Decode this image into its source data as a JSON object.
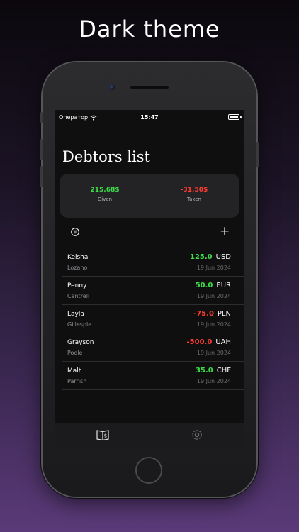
{
  "headline": "Dark theme",
  "status_bar": {
    "carrier": "Оператор",
    "time": "15:47"
  },
  "page_title": "Debtors list",
  "summary": {
    "given": {
      "amount": "215.68$",
      "label": "Given"
    },
    "taken": {
      "amount": "-31.50$",
      "label": "Taken"
    }
  },
  "toolbar": {
    "filter_icon": "filter-icon",
    "add_label": "+"
  },
  "debtors": [
    {
      "first": "Keisha",
      "last": "Lozano",
      "amount": "125.0",
      "currency": "USD",
      "date": "19 Jun 2024",
      "color": "#3ddc4a"
    },
    {
      "first": "Penny",
      "last": "Cantrell",
      "amount": "50.0",
      "currency": "EUR",
      "date": "19 Jun 2024",
      "color": "#3ddc4a"
    },
    {
      "first": "Layla",
      "last": "Gillespie",
      "amount": "-75.0",
      "currency": "PLN",
      "date": "19 Jun 2024",
      "color": "#ff3b30"
    },
    {
      "first": "Grayson",
      "last": "Poole",
      "amount": "-500.0",
      "currency": "UAH",
      "date": "19 Jun 2024",
      "color": "#ff3b30"
    },
    {
      "first": "Malt",
      "last": "Parrish",
      "amount": "35.0",
      "currency": "CHF",
      "date": "19 Jun 2024",
      "color": "#3ddc4a"
    }
  ],
  "tabs": [
    {
      "icon": "ledger-book-icon",
      "active": true
    },
    {
      "icon": "gear-icon",
      "active": false
    }
  ],
  "colors": {
    "positive": "#3ddc4a",
    "negative": "#ff3b30",
    "background": "#0f0f10",
    "card": "#232325"
  }
}
